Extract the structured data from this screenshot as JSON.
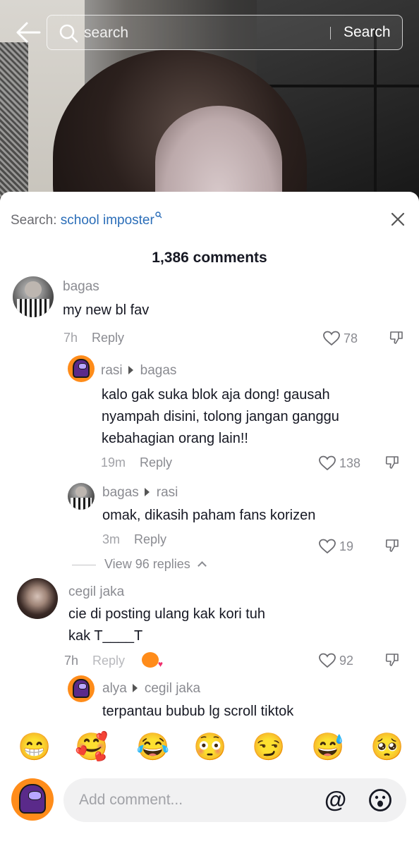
{
  "top_bar": {
    "search_placeholder": "search",
    "search_button": "Search"
  },
  "sheet": {
    "search_label": "Search:",
    "search_keyword": "school imposter",
    "comments_count": "1,386 comments"
  },
  "comments": [
    {
      "username": "bagas",
      "text": "my new bl fav",
      "time": "7h",
      "reply_label": "Reply",
      "likes": "78"
    },
    {
      "username": "rasi",
      "reply_to": "bagas",
      "text_lines": [
        "kalo gak suka blok aja dong! gausah",
        "nyampah disini, tolong jangan ganggu",
        "kebahagian orang lain!!"
      ],
      "time": "19m",
      "reply_label": "Reply",
      "likes": "138"
    },
    {
      "username": "bagas",
      "reply_to": "rasi",
      "text": "omak, dikasih paham fans korizen",
      "time": "3m",
      "reply_label": "Reply",
      "likes": "19"
    },
    {
      "username": "cegil jaka",
      "text_lines": [
        "cie di  posting ulang kak kori tuh",
        "kak T____T"
      ],
      "time": "7h",
      "reply_label": "Reply",
      "likes": "92"
    },
    {
      "username": "alya",
      "reply_to": "cegil jaka",
      "text": "terpantau bubub lg scroll tiktok"
    }
  ],
  "view_replies": "View 96 replies",
  "emoji_bar": [
    "😁",
    "🥰",
    "😂",
    "😳",
    "😏",
    "😅",
    "🥺"
  ],
  "composer": {
    "placeholder": "Add comment...",
    "mention_symbol": "@"
  },
  "icons": {
    "back": "back-arrow-icon",
    "search": "search-icon",
    "close": "close-icon",
    "like": "heart-icon",
    "dislike": "thumbs-down-icon",
    "emoji": "emoji-icon"
  },
  "colors": {
    "keyword_link": "#2a6db8",
    "avatar_orange": "#ff8c1a",
    "muted_text": "#8a8b91"
  }
}
